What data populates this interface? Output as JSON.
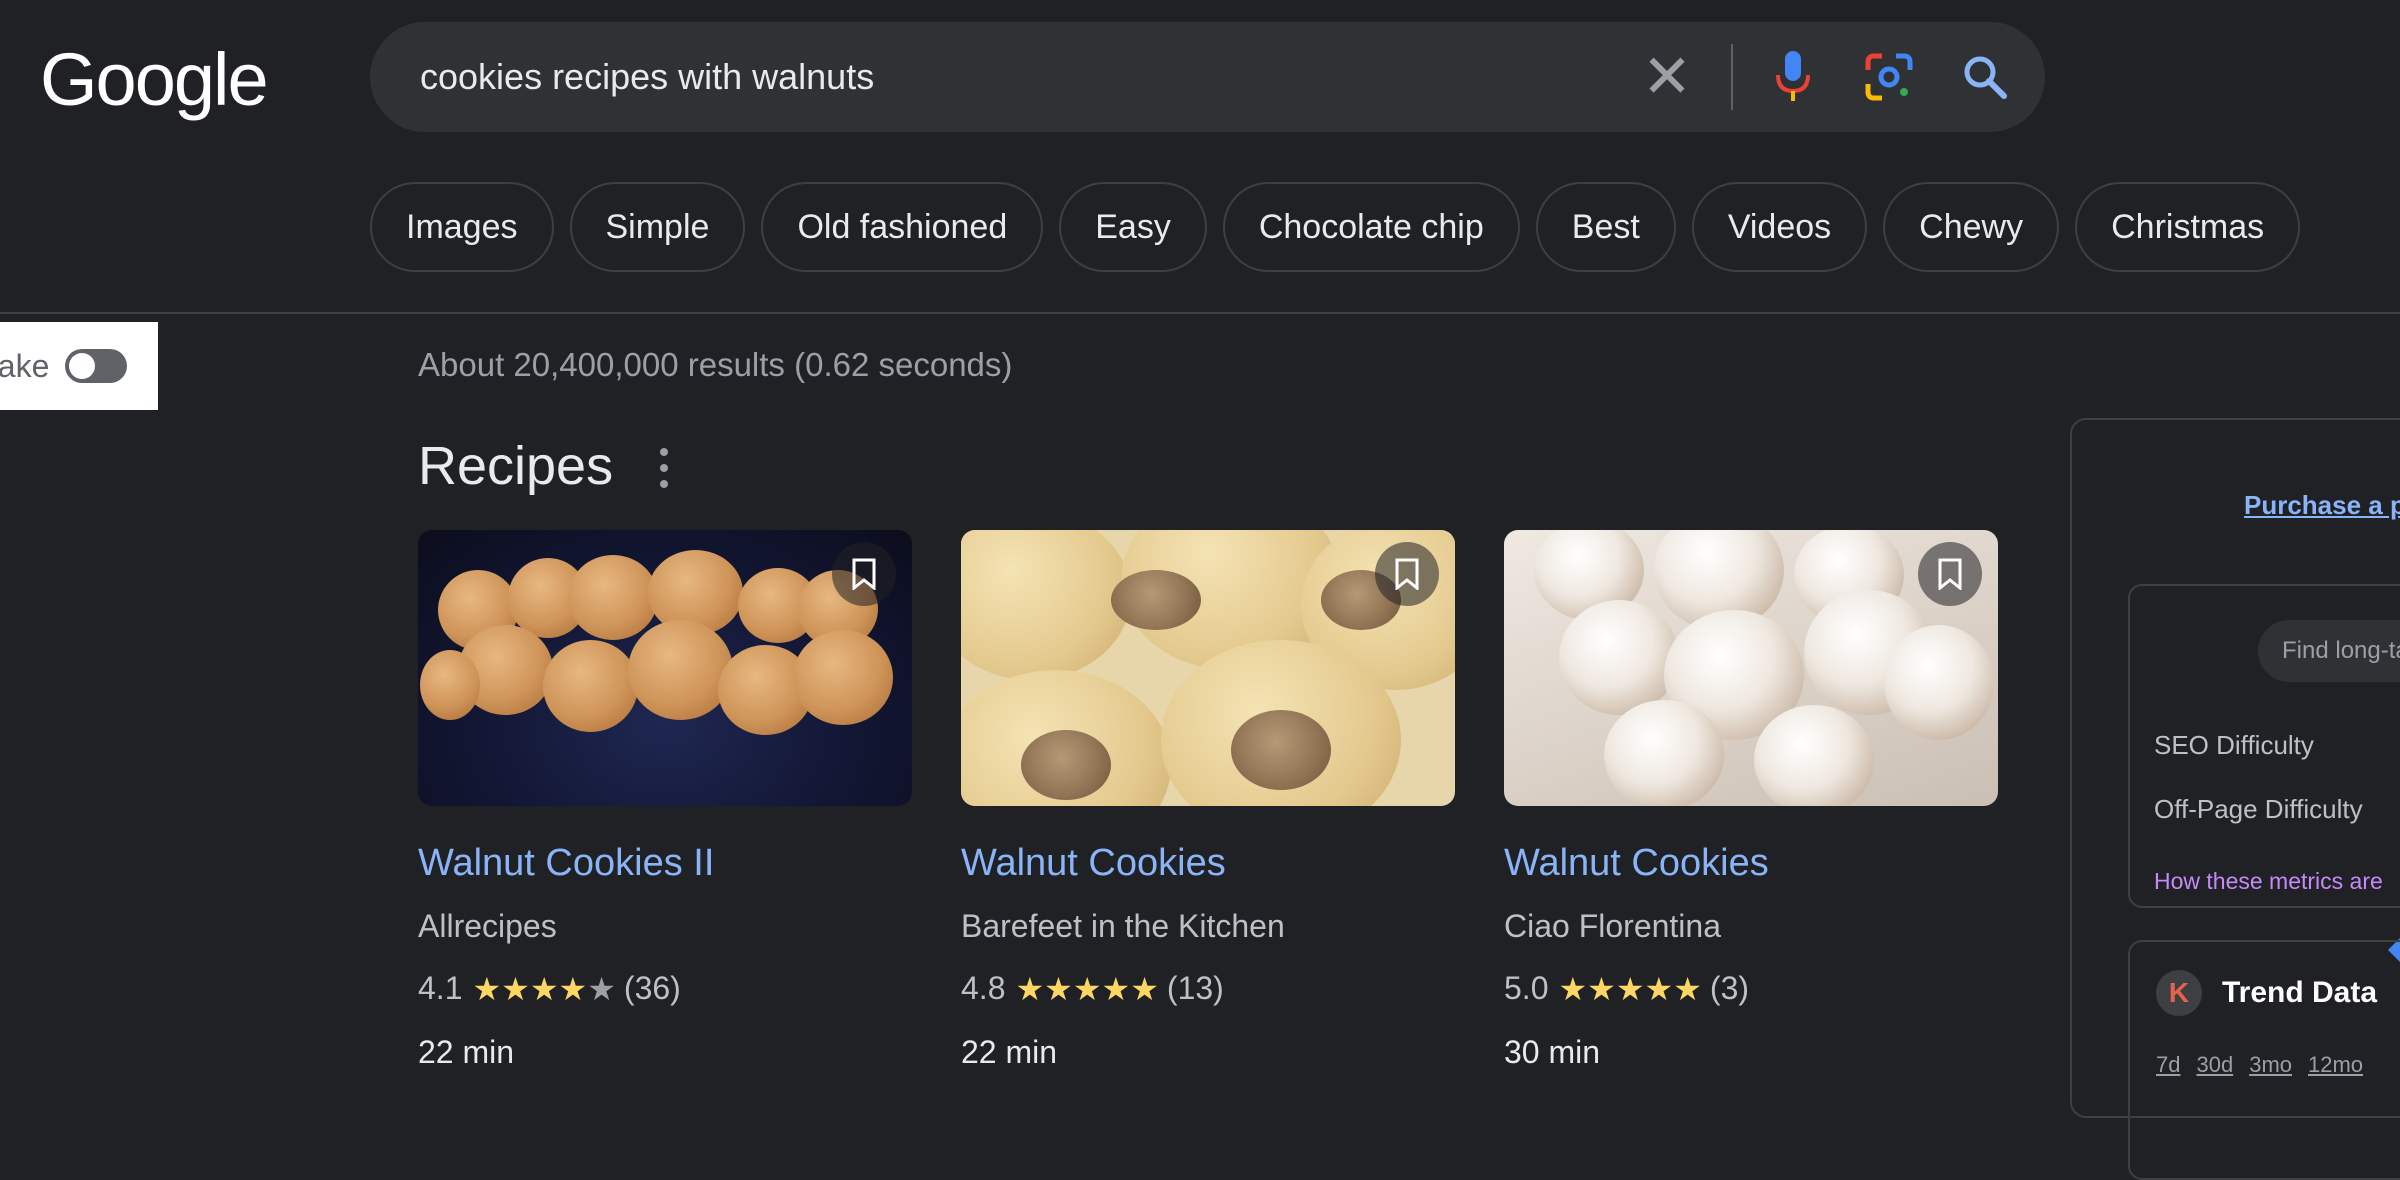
{
  "logo": {
    "text": "Google"
  },
  "search": {
    "query": "cookies recipes with walnuts",
    "clear_icon": "close-icon",
    "voice_icon": "mic-icon",
    "lens_icon": "camera-lens-icon",
    "search_icon": "search-icon"
  },
  "chips": [
    "Images",
    "Simple",
    "Old fashioned",
    "Easy",
    "Chocolate chip",
    "Best",
    "Videos",
    "Chewy",
    "Christmas"
  ],
  "extension_toggle": {
    "label": "uake",
    "enabled": false
  },
  "results_count": "About 20,400,000 results (0.62 seconds)",
  "recipes": {
    "heading": "Recipes",
    "cards": [
      {
        "title": "Walnut Cookies II",
        "source": "Allrecipes",
        "rating": "4.1",
        "stars": 4,
        "reviews": "(36)",
        "time": "22 min"
      },
      {
        "title": "Walnut Cookies",
        "source": "Barefeet in the Kitchen",
        "rating": "4.8",
        "stars": 5,
        "reviews": "(13)",
        "time": "22 min"
      },
      {
        "title": "Walnut Cookies",
        "source": "Ciao Florentina",
        "rating": "5.0",
        "stars": 5,
        "reviews": "(3)",
        "time": "30 min"
      }
    ]
  },
  "side_panel": {
    "purchase_link": "Purchase a p",
    "keyword_input_placeholder": "Find long-ta",
    "seo_difficulty": "SEO Difficulty",
    "offpage_difficulty": "Off-Page Difficulty",
    "metrics_link": "How these metrics are",
    "k_badge": "K",
    "trend_title": "Trend Data",
    "trend_tabs": [
      "7d",
      "30d",
      "3mo",
      "12mo"
    ]
  },
  "colors": {
    "background": "#202124",
    "link": "#8ab4f8",
    "star": "#fdd663",
    "search_box": "#303134"
  }
}
